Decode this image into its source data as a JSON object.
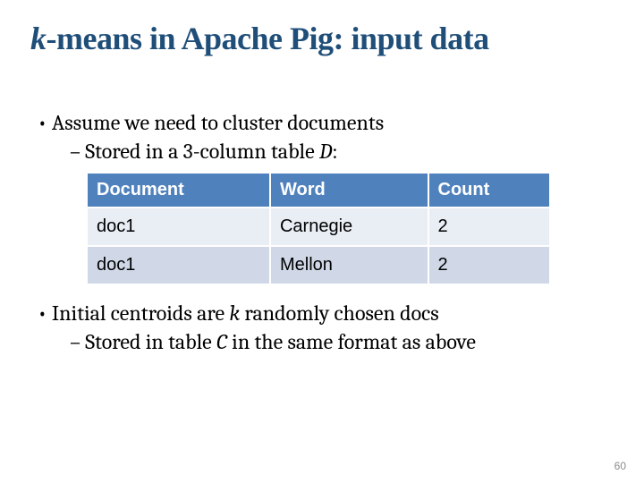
{
  "title": {
    "k": "k",
    "rest": "-means in Apache Pig: input data"
  },
  "bullets": {
    "b1": "Assume we need to cluster documents",
    "b1a_pre": "Stored in a 3-column table ",
    "b1a_it": "D",
    "b1a_post": ":",
    "b2_pre": "Initial centroids are ",
    "b2_it": "k",
    "b2_post": " randomly chosen docs",
    "b2a_pre": "Stored in table ",
    "b2a_it": "C",
    "b2a_post": " in the same format as above"
  },
  "table": {
    "headers": {
      "c0": "Document",
      "c1": "Word",
      "c2": "Count"
    },
    "rows": [
      {
        "c0": "doc1",
        "c1": "Carnegie",
        "c2": "2"
      },
      {
        "c0": "doc1",
        "c1": "Mellon",
        "c2": "2"
      }
    ]
  },
  "page_number": "60"
}
